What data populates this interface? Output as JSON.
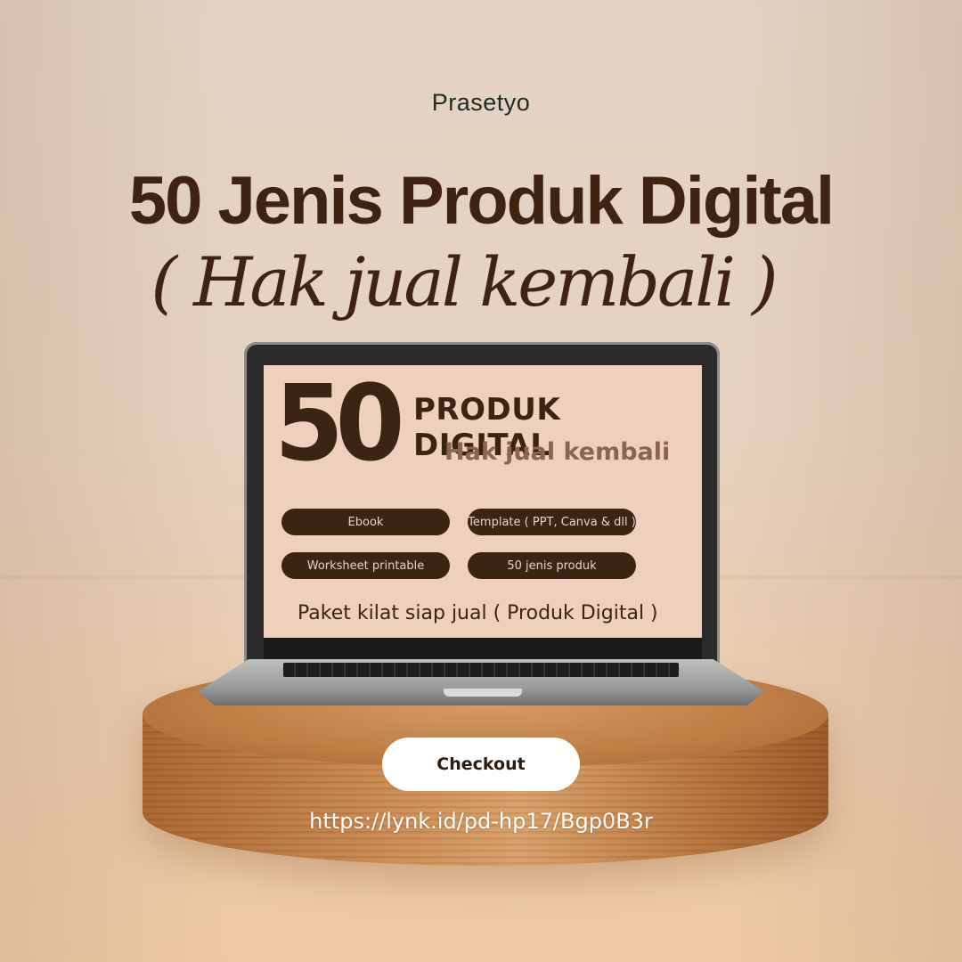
{
  "brand": "Prasetyo",
  "headline": {
    "title": "50 Jenis Produk Digital",
    "subtitle": "( Hak jual kembali )"
  },
  "screen": {
    "big_number": "50",
    "heading": "PRODUK DIGITAL",
    "subheading": "Hak jual kembali",
    "pills": [
      "Ebook",
      "Template ( PPT, Canva & dll )",
      "Worksheet printable",
      "50 jenis produk"
    ],
    "tagline": "Paket kilat siap jual ( Produk Digital )"
  },
  "cta": {
    "label": "Checkout",
    "url": "https://lynk.id/pd-hp17/Bgp0B3r"
  },
  "colors": {
    "accent_dark": "#3b2412",
    "screen_bg": "#eed0bd",
    "subheading": "#8a6550",
    "button_bg": "#ffffff"
  }
}
